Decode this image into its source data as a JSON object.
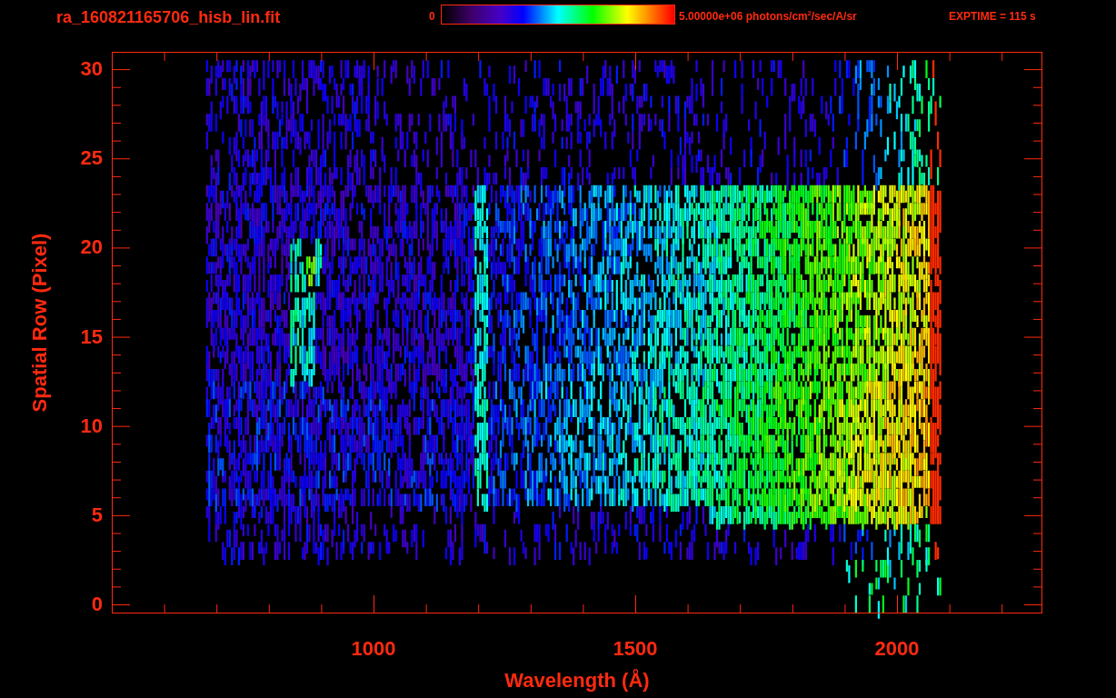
{
  "plot": {
    "title": "ra_160821165706_hisb_lin.fit",
    "colorbar": {
      "min_label": "0",
      "max_label": "5.00000e+06 photons/cm$^{2}$/sec/A/sr"
    },
    "exposure": "EXPTIME = 115 s",
    "x_axis": {
      "label": "Wavelength (Å)",
      "ticks": [
        "1000",
        "1500",
        "2000"
      ]
    },
    "y_axis": {
      "label": "Spatial Row (Pixel)",
      "ticks": [
        "30",
        "25",
        "20",
        "15",
        "10",
        "5",
        "0"
      ]
    }
  }
}
